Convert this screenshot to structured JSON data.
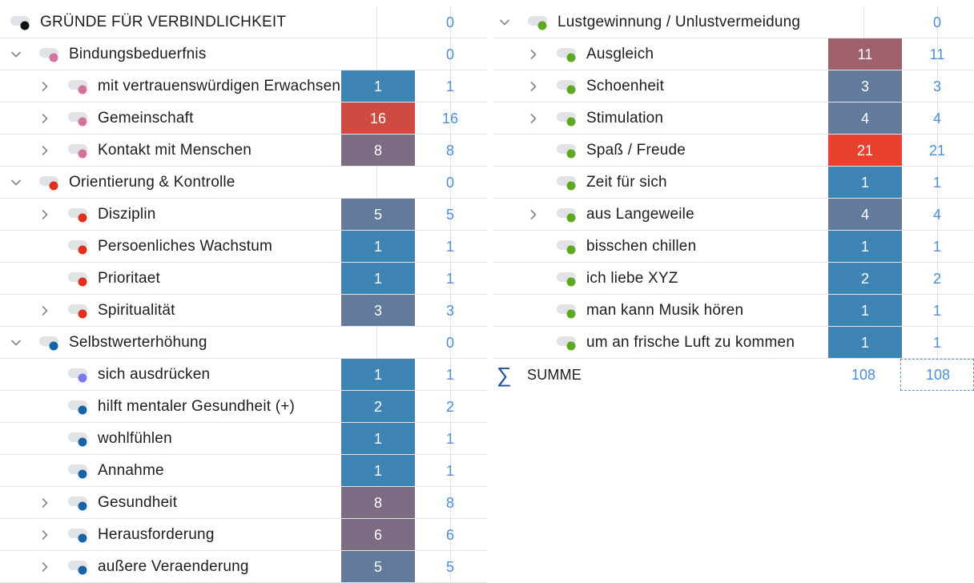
{
  "left": {
    "rows": [
      {
        "label": "GRÜNDE FÜR VERBINDLICHKEIT",
        "total": "0",
        "level": 0,
        "chev": "none",
        "dot": "#111111",
        "color": "",
        "count": ""
      },
      {
        "label": "Bindungsbeduerfnis",
        "total": "0",
        "level": 1,
        "chev": "down",
        "dot": "#d4739f",
        "color": "",
        "count": ""
      },
      {
        "label": "mit vertrauenswürdigen Erwachsenen",
        "total": "1",
        "level": 2,
        "chev": "right",
        "dot": "#d4739f",
        "color": "#3e84b5",
        "count": "1"
      },
      {
        "label": "Gemeinschaft",
        "total": "16",
        "level": 2,
        "chev": "right",
        "dot": "#d4739f",
        "color": "#cf4b42",
        "count": "16"
      },
      {
        "label": "Kontakt mit Menschen",
        "total": "8",
        "level": 2,
        "chev": "right",
        "dot": "#d4739f",
        "color": "#7d6b83",
        "count": "8"
      },
      {
        "label": "Orientierung & Kontrolle",
        "total": "0",
        "level": 1,
        "chev": "down",
        "dot": "#e0301e",
        "color": "",
        "count": ""
      },
      {
        "label": "Disziplin",
        "total": "5",
        "level": 2,
        "chev": "right",
        "dot": "#e0301e",
        "color": "#627a9c",
        "count": "5"
      },
      {
        "label": "Persoenliches Wachstum",
        "total": "1",
        "level": 2,
        "chev": "none",
        "dot": "#e0301e",
        "color": "#3e84b5",
        "count": "1"
      },
      {
        "label": "Prioritaet",
        "total": "1",
        "level": 2,
        "chev": "none",
        "dot": "#e0301e",
        "color": "#3e84b5",
        "count": "1"
      },
      {
        "label": "Spiritualität",
        "total": "3",
        "level": 2,
        "chev": "right",
        "dot": "#e0301e",
        "color": "#627a9c",
        "count": "3"
      },
      {
        "label": "Selbstwerterhöhung",
        "total": "0",
        "level": 1,
        "chev": "down",
        "dot": "#1565a8",
        "color": "",
        "count": ""
      },
      {
        "label": "sich ausdrücken",
        "total": "1",
        "level": 2,
        "chev": "none",
        "dot": "#7b78f0",
        "color": "#3e84b5",
        "count": "1"
      },
      {
        "label": "hilft mentaler Gesundheit (+)",
        "total": "2",
        "level": 2,
        "chev": "none",
        "dot": "#1565a8",
        "color": "#3e84b5",
        "count": "2"
      },
      {
        "label": "wohlfühlen",
        "total": "1",
        "level": 2,
        "chev": "none",
        "dot": "#1565a8",
        "color": "#3e84b5",
        "count": "1"
      },
      {
        "label": "Annahme",
        "total": "1",
        "level": 2,
        "chev": "none",
        "dot": "#1565a8",
        "color": "#3e84b5",
        "count": "1"
      },
      {
        "label": "Gesundheit",
        "total": "8",
        "level": 2,
        "chev": "right",
        "dot": "#1565a8",
        "color": "#7d6b83",
        "count": "8"
      },
      {
        "label": "Herausforderung",
        "total": "6",
        "level": 2,
        "chev": "right",
        "dot": "#1565a8",
        "color": "#7d6b83",
        "count": "6"
      },
      {
        "label": "außere Veraenderung",
        "total": "5",
        "level": 2,
        "chev": "right",
        "dot": "#1565a8",
        "color": "#627a9c",
        "count": "5"
      }
    ]
  },
  "right": {
    "rows": [
      {
        "label": "Lustgewinnung / Unlustvermeidung",
        "total": "0",
        "level": 1,
        "chev": "down",
        "dot": "#5fa821",
        "color": "",
        "count": ""
      },
      {
        "label": "Ausgleich",
        "total": "11",
        "level": 2,
        "chev": "right",
        "dot": "#5fa821",
        "color": "#a0616f",
        "count": "11"
      },
      {
        "label": "Schoenheit",
        "total": "3",
        "level": 2,
        "chev": "right",
        "dot": "#5fa821",
        "color": "#627a9c",
        "count": "3"
      },
      {
        "label": "Stimulation",
        "total": "4",
        "level": 2,
        "chev": "right",
        "dot": "#5fa821",
        "color": "#627a9c",
        "count": "4"
      },
      {
        "label": "Spaß / Freude",
        "total": "21",
        "level": 2,
        "chev": "none",
        "dot": "#5fa821",
        "color": "#e8412d",
        "count": "21"
      },
      {
        "label": "Zeit für sich",
        "total": "1",
        "level": 2,
        "chev": "none",
        "dot": "#5fa821",
        "color": "#3e84b5",
        "count": "1"
      },
      {
        "label": "aus Langeweile",
        "total": "4",
        "level": 2,
        "chev": "right",
        "dot": "#5fa821",
        "color": "#627a9c",
        "count": "4"
      },
      {
        "label": "bisschen chillen",
        "total": "1",
        "level": 2,
        "chev": "none",
        "dot": "#5fa821",
        "color": "#3e84b5",
        "count": "1"
      },
      {
        "label": "ich liebe XYZ",
        "total": "2",
        "level": 2,
        "chev": "none",
        "dot": "#5fa821",
        "color": "#3e84b5",
        "count": "2"
      },
      {
        "label": "man kann Musik hören",
        "total": "1",
        "level": 2,
        "chev": "none",
        "dot": "#5fa821",
        "color": "#3e84b5",
        "count": "1"
      },
      {
        "label": "um an frische Luft zu kommen",
        "total": "1",
        "level": 2,
        "chev": "none",
        "dot": "#5fa821",
        "color": "#3e84b5",
        "count": "1"
      }
    ],
    "summary": {
      "symbol": "∑",
      "label": "SUMME",
      "value": "108",
      "total": "108"
    }
  }
}
